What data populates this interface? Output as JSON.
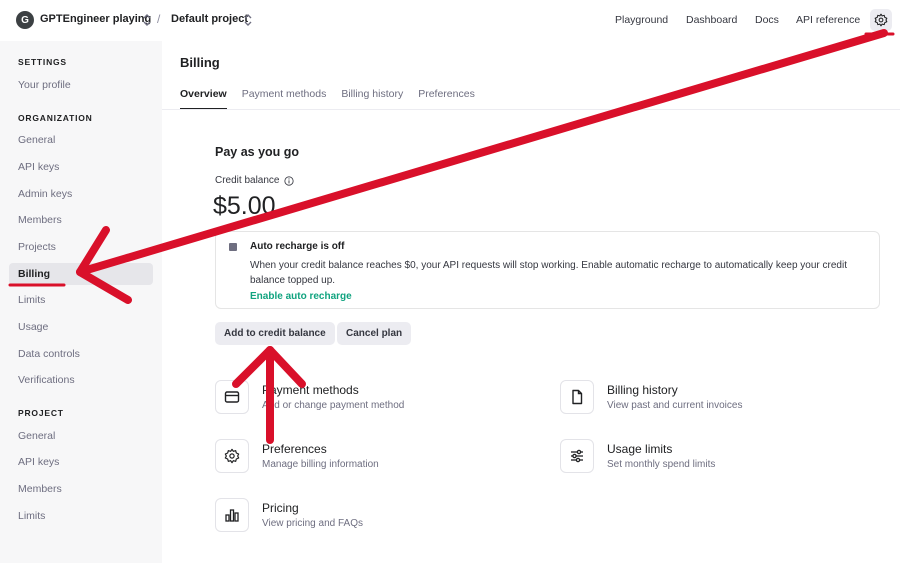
{
  "topbar": {
    "org_initial": "G",
    "org_name": "GPTEngineer playing",
    "separator": "/",
    "project_name": "Default project",
    "nav": [
      "Playground",
      "Dashboard",
      "Docs",
      "API reference"
    ]
  },
  "sidebar": {
    "settings_header": "SETTINGS",
    "settings_items": [
      "Your profile"
    ],
    "org_header": "ORGANIZATION",
    "org_items": [
      "General",
      "API keys",
      "Admin keys",
      "Members",
      "Projects",
      "Billing",
      "Limits",
      "Usage",
      "Data controls",
      "Verifications"
    ],
    "project_header": "PROJECT",
    "project_items": [
      "General",
      "API keys",
      "Members",
      "Limits"
    ],
    "active_item": "Billing"
  },
  "main": {
    "title": "Billing",
    "tabs": [
      "Overview",
      "Payment methods",
      "Billing history",
      "Preferences"
    ],
    "active_tab": "Overview",
    "section_title": "Pay as you go",
    "credit_label": "Credit balance",
    "credit_value": "$5.00",
    "notice": {
      "title": "Auto recharge is off",
      "body": "When your credit balance reaches $0, your API requests will stop working. Enable automatic recharge to automatically keep your credit balance topped up.",
      "link": "Enable auto recharge"
    },
    "buttons": {
      "add_credit": "Add to credit balance",
      "cancel": "Cancel plan"
    },
    "cards": [
      {
        "title": "Payment methods",
        "subtitle": "Add or change payment method",
        "icon": "card-icon"
      },
      {
        "title": "Billing history",
        "subtitle": "View past and current invoices",
        "icon": "document-icon"
      },
      {
        "title": "Preferences",
        "subtitle": "Manage billing information",
        "icon": "gear-icon"
      },
      {
        "title": "Usage limits",
        "subtitle": "Set monthly spend limits",
        "icon": "sliders-icon"
      },
      {
        "title": "Pricing",
        "subtitle": "View pricing and FAQs",
        "icon": "bar-chart-icon"
      }
    ]
  },
  "colors": {
    "accent_green": "#10a37f",
    "annotation_red": "#d9102a",
    "sidebar_bg": "#f7f7f8"
  }
}
